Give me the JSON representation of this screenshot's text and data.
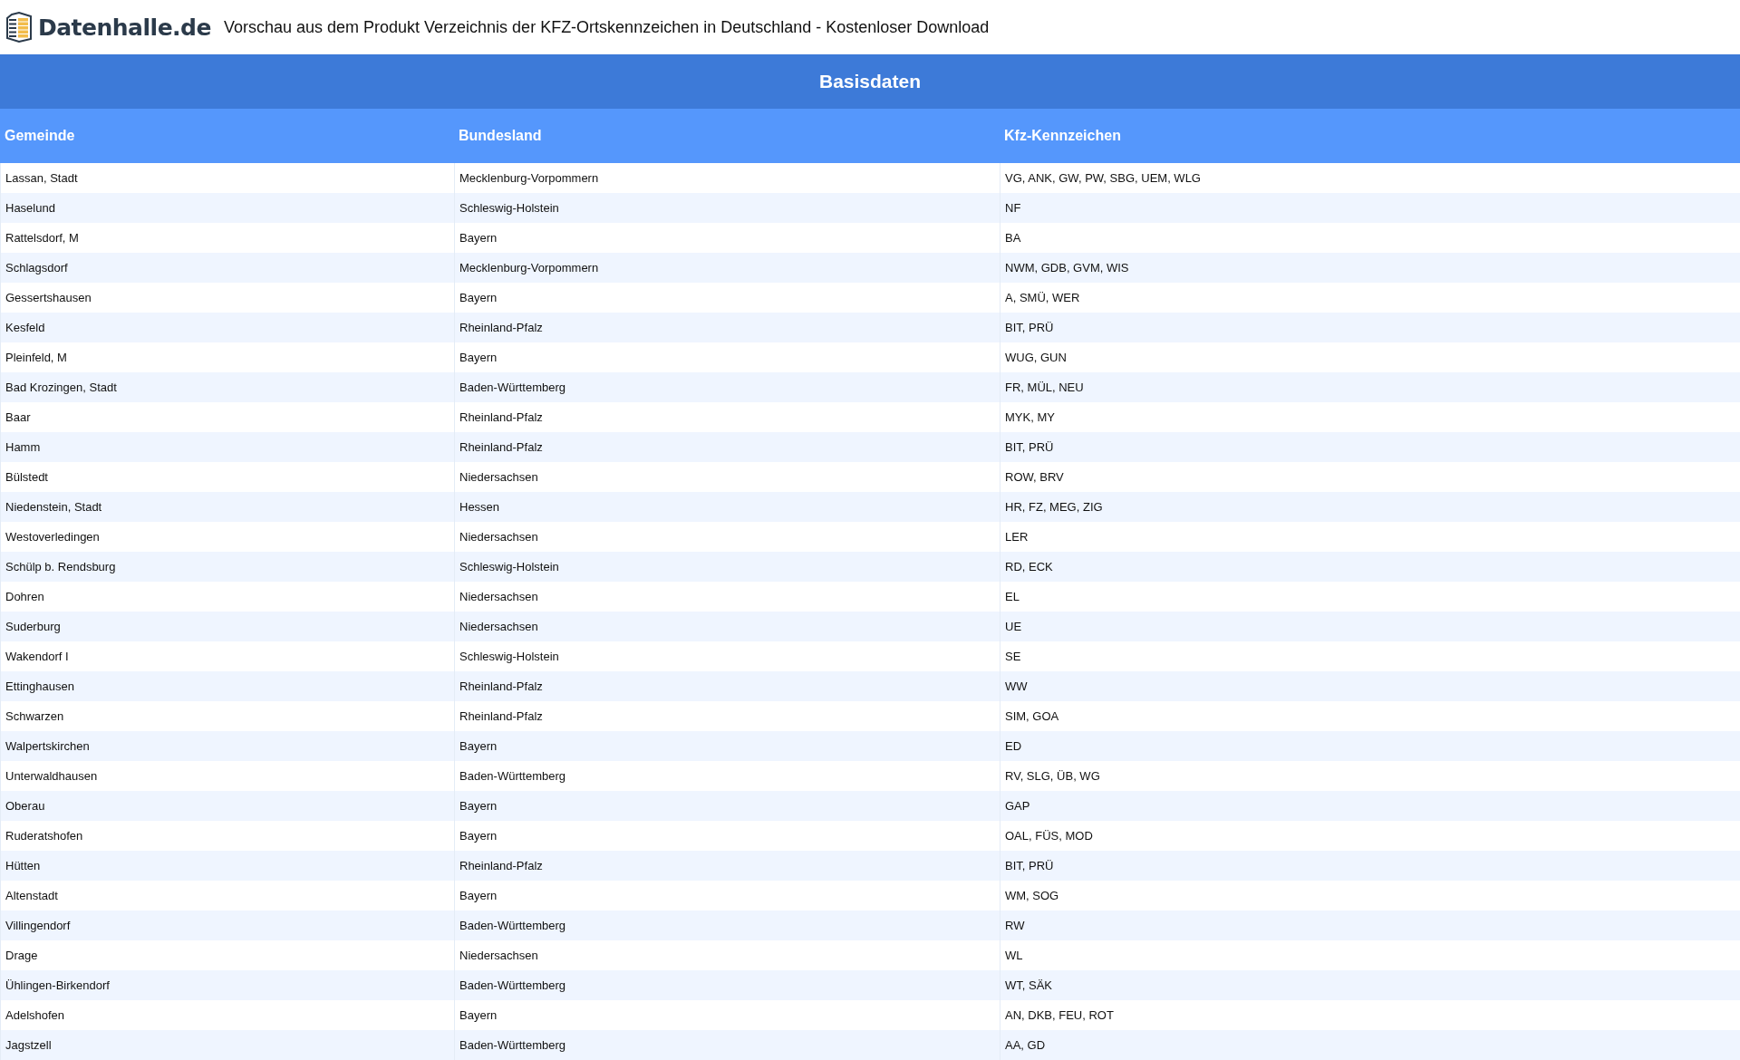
{
  "header": {
    "logo": "Datenhalle.de",
    "title": "Vorschau aus dem Produkt Verzeichnis der KFZ-Ortskennzeichen in Deutschland - Kostenloser Download"
  },
  "table": {
    "caption": "Basisdaten",
    "columns": [
      "Gemeinde",
      "Bundesland",
      "Kfz-Kennzeichen"
    ],
    "rows": [
      [
        "Lassan, Stadt",
        "Mecklenburg-Vorpommern",
        "VG, ANK, GW, PW, SBG, UEM, WLG"
      ],
      [
        "Haselund",
        "Schleswig-Holstein",
        "NF"
      ],
      [
        "Rattelsdorf, M",
        "Bayern",
        "BA"
      ],
      [
        "Schlagsdorf",
        "Mecklenburg-Vorpommern",
        "NWM, GDB, GVM, WIS"
      ],
      [
        "Gessertshausen",
        "Bayern",
        "A, SMÜ, WER"
      ],
      [
        "Kesfeld",
        "Rheinland-Pfalz",
        "BIT, PRÜ"
      ],
      [
        "Pleinfeld, M",
        "Bayern",
        "WUG, GUN"
      ],
      [
        "Bad Krozingen, Stadt",
        "Baden-Württemberg",
        "FR, MÜL, NEU"
      ],
      [
        "Baar",
        "Rheinland-Pfalz",
        "MYK, MY"
      ],
      [
        "Hamm",
        "Rheinland-Pfalz",
        "BIT, PRÜ"
      ],
      [
        "Bülstedt",
        "Niedersachsen",
        "ROW, BRV"
      ],
      [
        "Niedenstein, Stadt",
        "Hessen",
        "HR, FZ, MEG, ZIG"
      ],
      [
        "Westoverledingen",
        "Niedersachsen",
        "LER"
      ],
      [
        "Schülp b. Rendsburg",
        "Schleswig-Holstein",
        "RD, ECK"
      ],
      [
        "Dohren",
        "Niedersachsen",
        "EL"
      ],
      [
        "Suderburg",
        "Niedersachsen",
        "UE"
      ],
      [
        "Wakendorf I",
        "Schleswig-Holstein",
        "SE"
      ],
      [
        "Ettinghausen",
        "Rheinland-Pfalz",
        "WW"
      ],
      [
        "Schwarzen",
        "Rheinland-Pfalz",
        "SIM, GOA"
      ],
      [
        "Walpertskirchen",
        "Bayern",
        "ED"
      ],
      [
        "Unterwaldhausen",
        "Baden-Württemberg",
        "RV, SLG, ÜB, WG"
      ],
      [
        "Oberau",
        "Bayern",
        "GAP"
      ],
      [
        "Ruderatshofen",
        "Bayern",
        "OAL, FÜS, MOD"
      ],
      [
        "Hütten",
        "Rheinland-Pfalz",
        "BIT, PRÜ"
      ],
      [
        "Altenstadt",
        "Bayern",
        "WM, SOG"
      ],
      [
        "Villingendorf",
        "Baden-Württemberg",
        "RW"
      ],
      [
        "Drage",
        "Niedersachsen",
        "WL"
      ],
      [
        "Ühlingen-Birkendorf",
        "Baden-Württemberg",
        "WT, SÄK"
      ],
      [
        "Adelshofen",
        "Bayern",
        "AN, DKB, FEU, ROT"
      ],
      [
        "Jagstzell",
        "Baden-Württemberg",
        "AA, GD"
      ]
    ]
  }
}
